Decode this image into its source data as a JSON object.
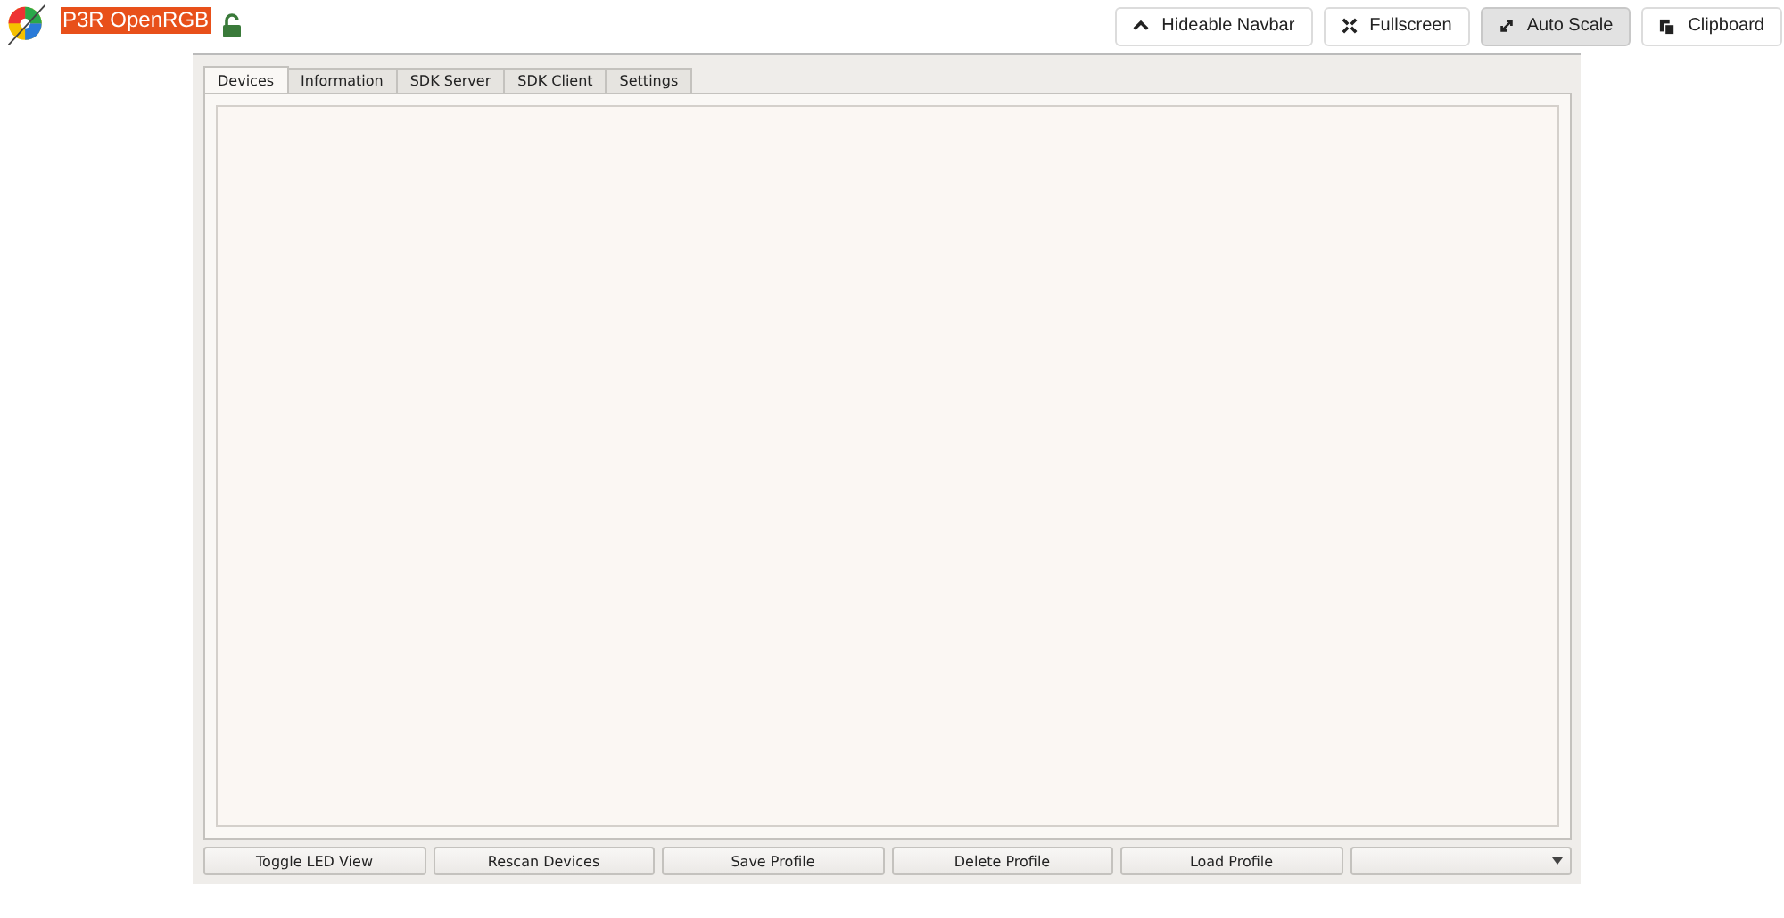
{
  "navbar": {
    "title": "P3R OpenRGB",
    "locked": false,
    "buttons": [
      {
        "label": "Hideable Navbar",
        "kind": "caret",
        "pressed": false
      },
      {
        "label": "Fullscreen",
        "kind": "fullscreen",
        "pressed": false
      },
      {
        "label": "Auto Scale",
        "kind": "scale",
        "pressed": true
      },
      {
        "label": "Clipboard",
        "kind": "clipboard",
        "pressed": false
      }
    ]
  },
  "tabs": [
    {
      "label": "Devices",
      "selected": true
    },
    {
      "label": "Information",
      "selected": false
    },
    {
      "label": "SDK Server",
      "selected": false
    },
    {
      "label": "SDK Client",
      "selected": false
    },
    {
      "label": "Settings",
      "selected": false
    }
  ],
  "buttons": [
    "Toggle LED View",
    "Rescan Devices",
    "Save Profile",
    "Delete Profile",
    "Load Profile"
  ],
  "profile_dropdown": {
    "kind": "dropdown"
  }
}
